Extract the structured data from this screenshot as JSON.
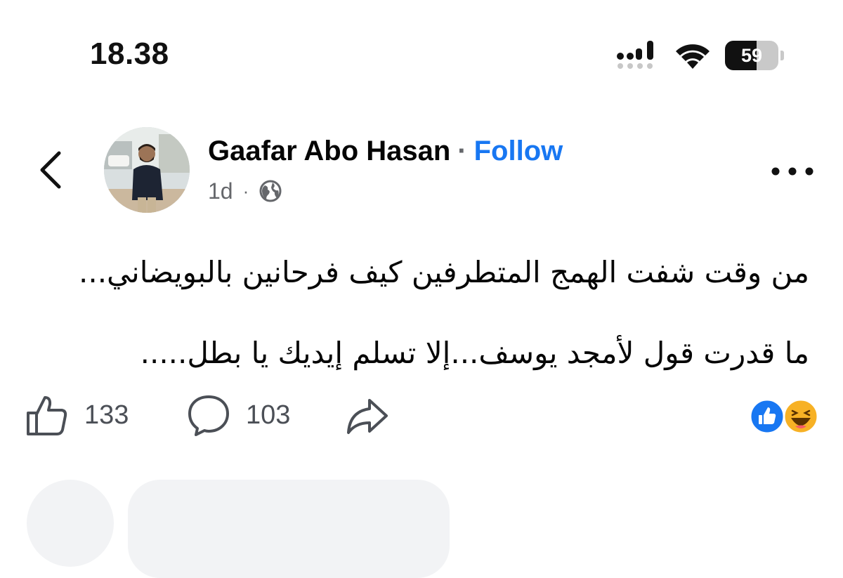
{
  "status_bar": {
    "time": "18.38",
    "battery_level": "59",
    "battery_fraction": 0.59,
    "icons": [
      "signal-icon",
      "wifi-icon",
      "battery-icon"
    ]
  },
  "post": {
    "author": "Gaafar Abo Hasan",
    "separator": "·",
    "follow_label": "Follow",
    "time": "1d",
    "meta_separator": "·",
    "audience_icon": "globe-icon",
    "text_lines": [
      "من وقت شفت الهمج المتطرفين كيف فرحانين بالبويضاني...",
      "ما قدرت قول لأمجد يوسف...إلا تسلم إيديك يا بطل....."
    ],
    "likes": "133",
    "comments": "103",
    "reactions": [
      "like-reaction-icon",
      "haha-reaction-icon"
    ]
  },
  "colors": {
    "accent": "#1877f2",
    "secondary_text": "#65676b",
    "haha_yellow": "#f7b125"
  }
}
